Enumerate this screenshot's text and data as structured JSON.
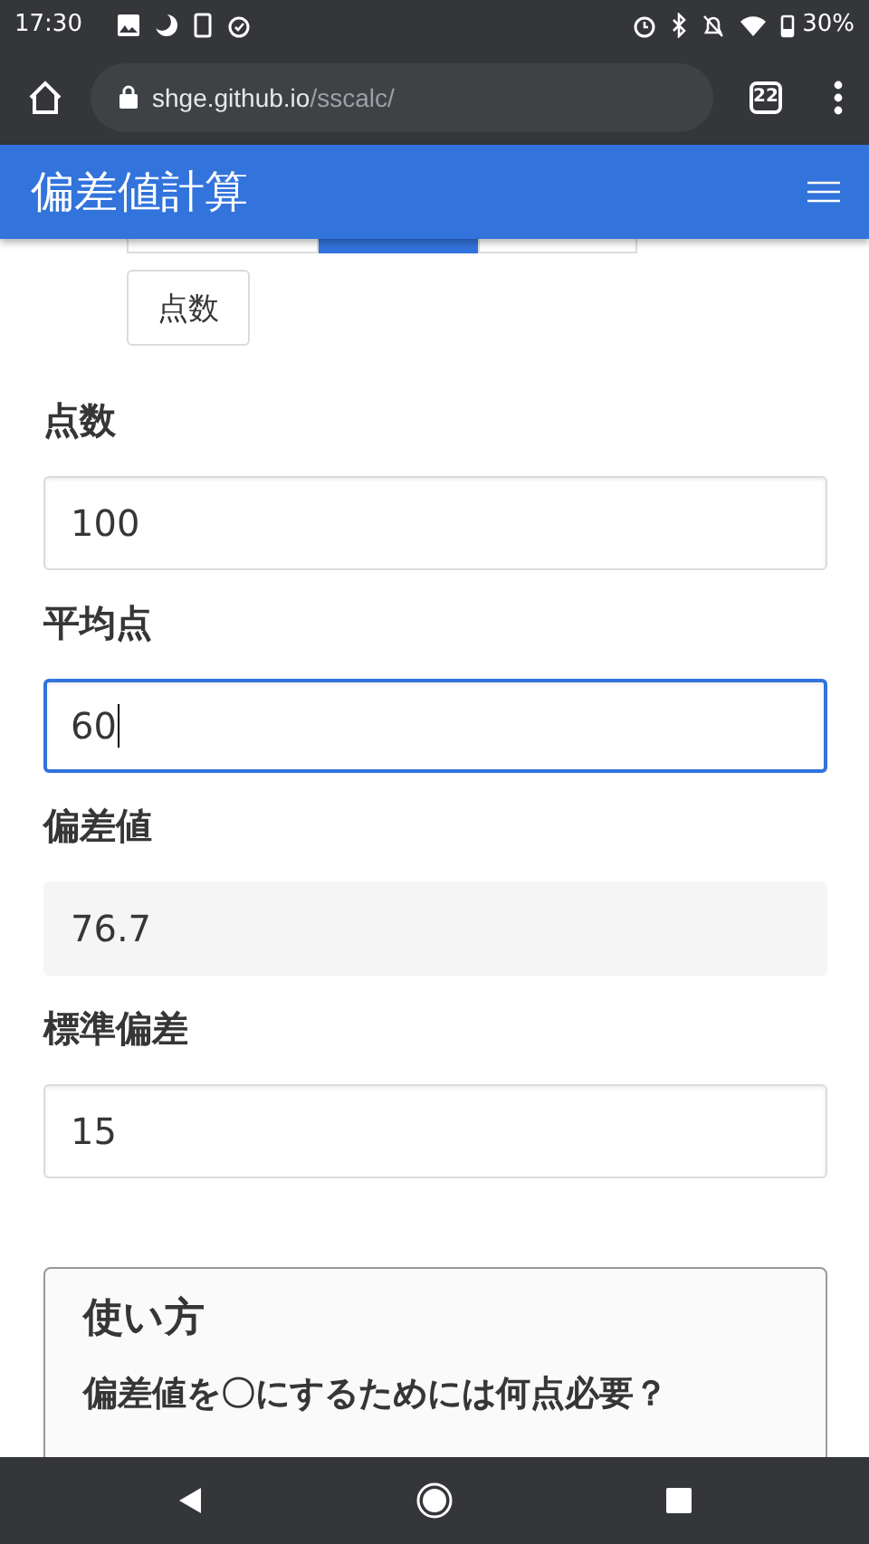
{
  "status_bar": {
    "time": "17:30",
    "battery": "30%"
  },
  "browser": {
    "domain": "shge.github.io",
    "path": "/sscalc/",
    "tab_count": "22"
  },
  "header": {
    "title": "偏差値計算"
  },
  "tabs": [
    {
      "selected": false
    },
    {
      "selected": true
    },
    {
      "selected": false
    }
  ],
  "mode_button": "点数",
  "fields": [
    {
      "label": "点数",
      "value": "100",
      "kind": "input",
      "focused": false
    },
    {
      "label": "平均点",
      "value": "60",
      "kind": "input",
      "focused": true
    },
    {
      "label": "偏差値",
      "value": "76.7",
      "kind": "output"
    },
    {
      "label": "標準偏差",
      "value": "15",
      "kind": "input",
      "focused": false
    }
  ],
  "card": {
    "title": "使い方",
    "subtitle": "偏差値を〇にするためには何点必要？"
  }
}
